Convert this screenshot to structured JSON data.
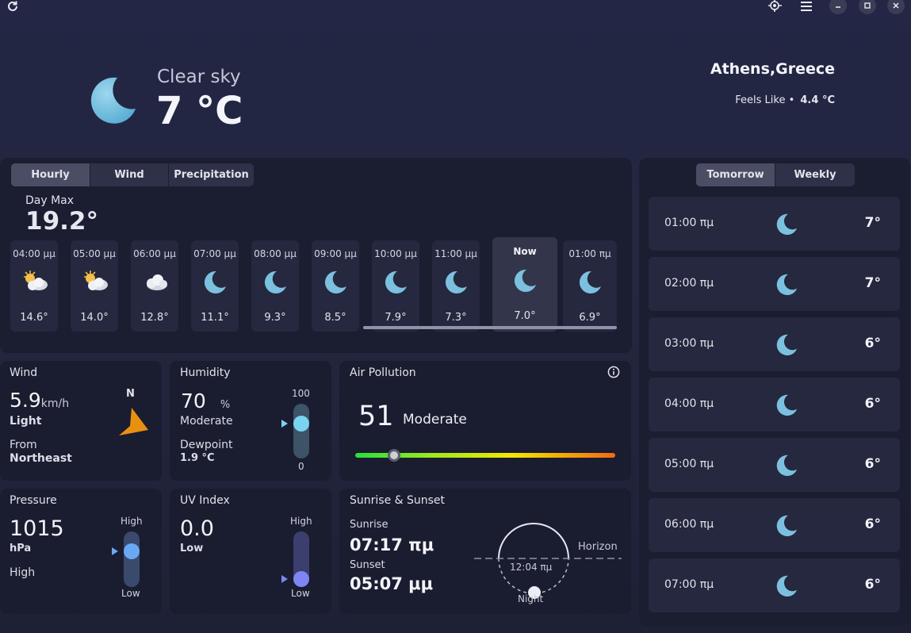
{
  "titlebar": {
    "refresh_icon": "refresh-icon",
    "location_icon": "location-target-icon",
    "menu_icon": "hamburger-menu-icon",
    "minimize_icon": "minimize-icon",
    "maximize_icon": "maximize-icon",
    "close_icon": "close-icon"
  },
  "current": {
    "icon": "moon-icon",
    "condition": "Clear sky",
    "temperature": "7 °C",
    "location": "Athens,Greece",
    "feels_like_label": "Feels Like •",
    "feels_like_value": "4.4 °C"
  },
  "forecast_tabs": [
    "Hourly",
    "Wind",
    "Precipitation"
  ],
  "forecast_active_tab": "Hourly",
  "day_max": {
    "label": "Day Max",
    "value": "19.2°"
  },
  "hourly": [
    {
      "time": "04:00 μμ",
      "icon": "partly-cloudy-day-icon",
      "temp": "14.6°"
    },
    {
      "time": "05:00 μμ",
      "icon": "partly-cloudy-day-icon",
      "temp": "14.0°"
    },
    {
      "time": "06:00 μμ",
      "icon": "cloudy-icon",
      "temp": "12.8°"
    },
    {
      "time": "07:00 μμ",
      "icon": "moon-icon",
      "temp": "11.1°"
    },
    {
      "time": "08:00 μμ",
      "icon": "moon-icon",
      "temp": "9.3°"
    },
    {
      "time": "09:00 μμ",
      "icon": "moon-icon",
      "temp": "8.5°"
    },
    {
      "time": "10:00 μμ",
      "icon": "moon-icon",
      "temp": "7.9°"
    },
    {
      "time": "11:00 μμ",
      "icon": "moon-icon",
      "temp": "7.3°"
    },
    {
      "time": "Now",
      "icon": "moon-icon",
      "temp": "7.0°"
    },
    {
      "time": "01:00 πμ",
      "icon": "moon-icon",
      "temp": "6.9°"
    }
  ],
  "wind": {
    "title": "Wind",
    "speed": "5.9",
    "unit": "km/h",
    "description": "Light",
    "from_label": "From",
    "direction": "Northeast",
    "compass_label": "N",
    "icon": "wind-direction-arrow-icon"
  },
  "humidity": {
    "title": "Humidity",
    "value": "70",
    "unit": "%",
    "level": "Moderate",
    "dewpoint_label": "Dewpoint",
    "dewpoint_value": "1.9 °C",
    "scale_max": "100",
    "scale_min": "0",
    "fraction": 0.7
  },
  "air_pollution": {
    "title": "Air Pollution",
    "value": "51",
    "level": "Moderate",
    "info_icon": "info-icon",
    "fraction": 0.15
  },
  "pressure": {
    "title": "Pressure",
    "value": "1015",
    "unit": "hPa",
    "level": "High",
    "scale_high": "High",
    "scale_low": "Low",
    "fraction": 0.7
  },
  "uv_index": {
    "title": "UV Index",
    "value": "0.0",
    "level": "Low",
    "scale_high": "High",
    "scale_low": "Low",
    "fraction": 0.0
  },
  "sun": {
    "title": "Sunrise & Sunset",
    "sunrise_label": "Sunrise",
    "sunrise": "07:17 πμ",
    "sunset_label": "Sunset",
    "sunset": "05:07 μμ",
    "horizon_label": "Horizon",
    "solar_time": "12:04 πμ",
    "night_label": "Night"
  },
  "side_tabs": [
    "Tomorrow",
    "Weekly"
  ],
  "side_active_tab": "Tomorrow",
  "tomorrow": [
    {
      "time": "01:00 πμ",
      "icon": "moon-icon",
      "temp": "7°"
    },
    {
      "time": "02:00 πμ",
      "icon": "moon-icon",
      "temp": "7°"
    },
    {
      "time": "03:00 πμ",
      "icon": "moon-icon",
      "temp": "6°"
    },
    {
      "time": "04:00 πμ",
      "icon": "moon-icon",
      "temp": "6°"
    },
    {
      "time": "05:00 πμ",
      "icon": "moon-icon",
      "temp": "6°"
    },
    {
      "time": "06:00 πμ",
      "icon": "moon-icon",
      "temp": "6°"
    },
    {
      "time": "07:00 πμ",
      "icon": "moon-icon",
      "temp": "6°"
    }
  ],
  "colors": {
    "moon": "#7cc0df",
    "accent_dial": "#7ad3f0",
    "wind_arrow": "#e8900f",
    "aqi_gradient": [
      "#27e03a",
      "#f4e800",
      "#f16a12"
    ]
  }
}
